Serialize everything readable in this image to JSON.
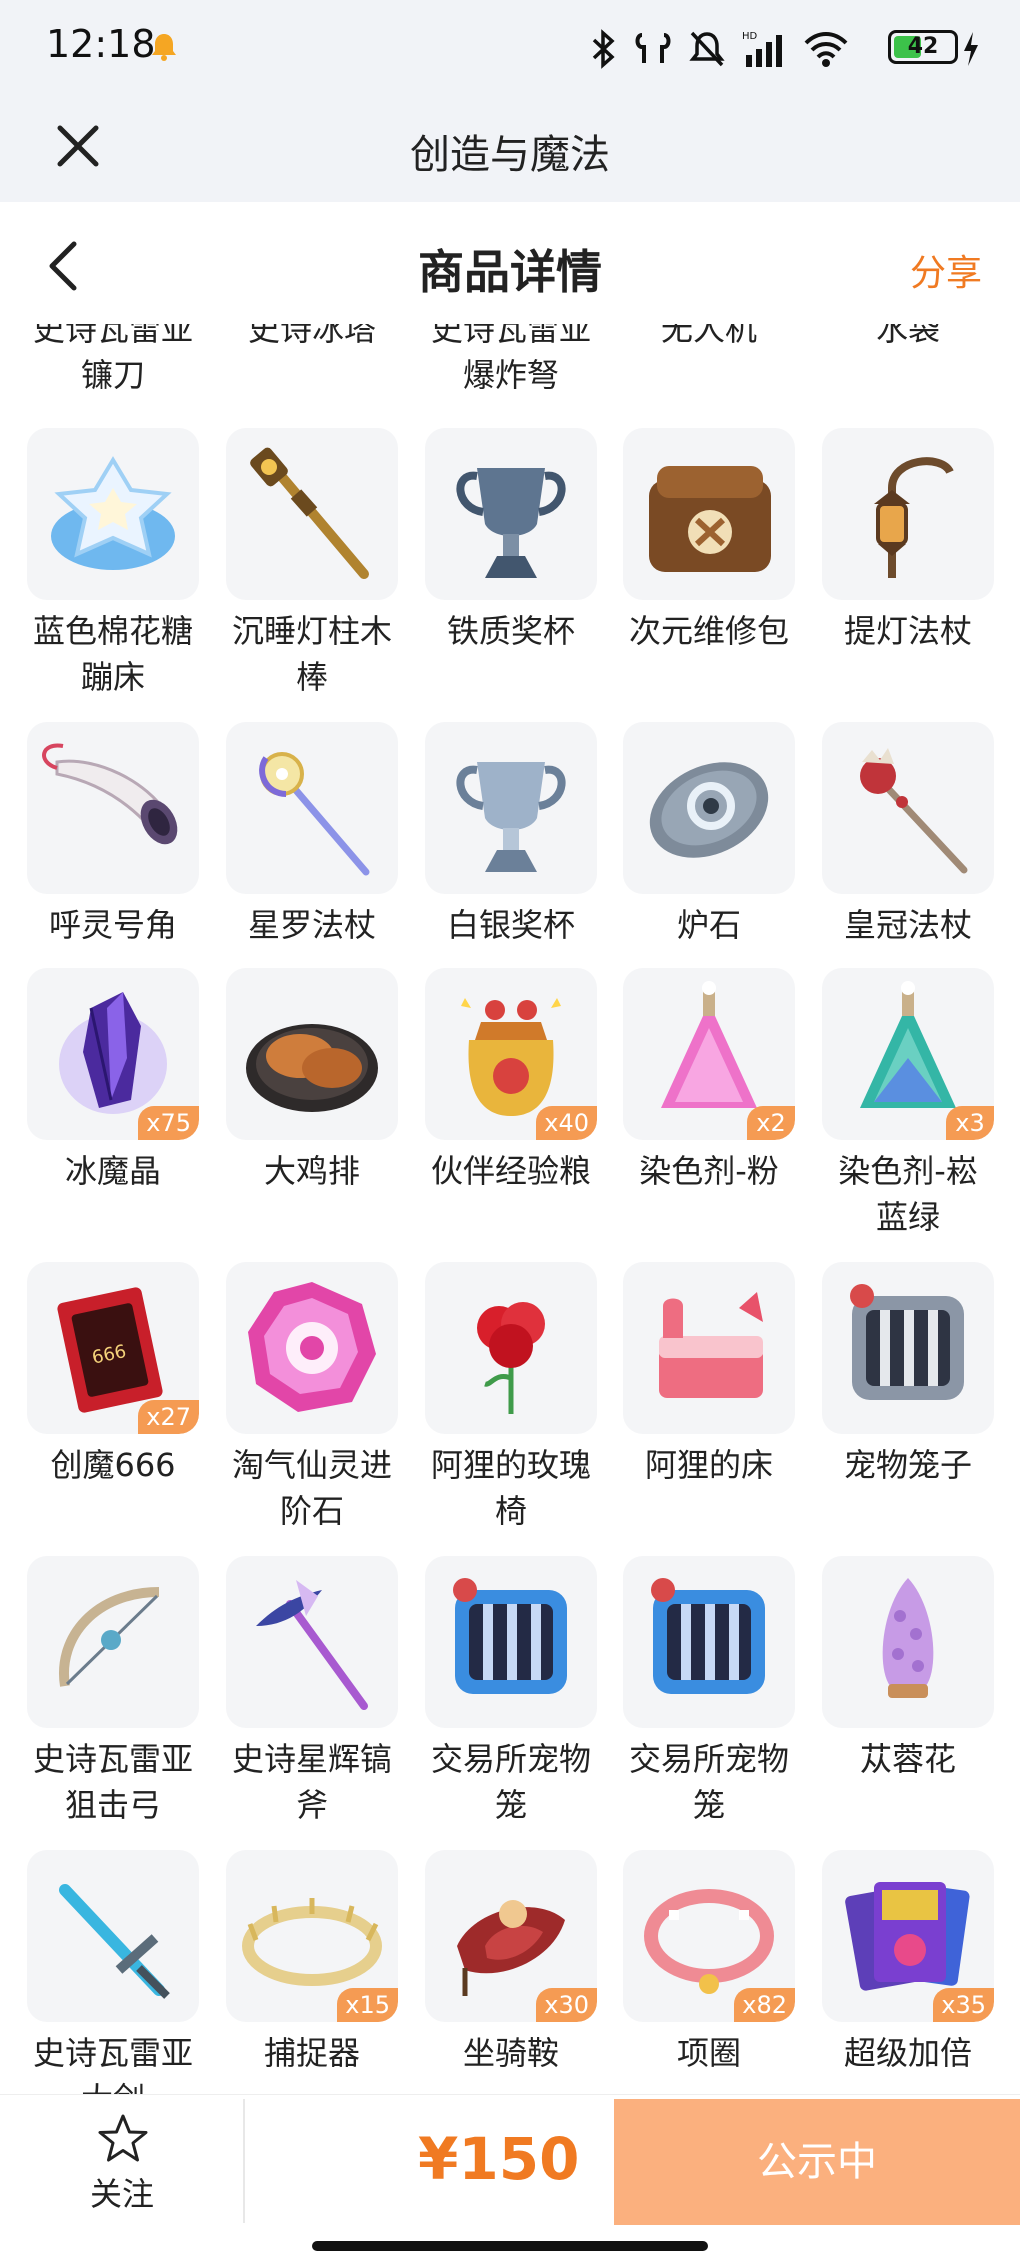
{
  "status_bar": {
    "time": "12:18",
    "battery": "42"
  },
  "app_bar": {
    "title": "创造与魔法"
  },
  "header": {
    "title": "商品详情",
    "share": "分享"
  },
  "grid": {
    "partial_row": [
      {
        "name": "史诗瓦雷亚\n镰刀"
      },
      {
        "name": "史诗冰塔"
      },
      {
        "name": "史诗瓦雷亚\n爆炸弩"
      },
      {
        "name": "无人机"
      },
      {
        "name": "水袋"
      }
    ],
    "rows": [
      [
        {
          "name": "蓝色棉花糖蹦床",
          "icon": "cotton-candy-trampoline-icon",
          "qty": ""
        },
        {
          "name": "沉睡灯柱木棒",
          "icon": "lamp-post-stick-icon",
          "qty": ""
        },
        {
          "name": "铁质奖杯",
          "icon": "iron-trophy-icon",
          "qty": ""
        },
        {
          "name": "次元维修包",
          "icon": "repair-bag-icon",
          "qty": ""
        },
        {
          "name": "提灯法杖",
          "icon": "lantern-staff-icon",
          "qty": ""
        }
      ],
      [
        {
          "name": "呼灵号角",
          "icon": "horn-icon",
          "qty": ""
        },
        {
          "name": "星罗法杖",
          "icon": "star-staff-icon",
          "qty": ""
        },
        {
          "name": "白银奖杯",
          "icon": "silver-trophy-icon",
          "qty": ""
        },
        {
          "name": "炉石",
          "icon": "hearthstone-icon",
          "qty": ""
        },
        {
          "name": "皇冠法杖",
          "icon": "crown-staff-icon",
          "qty": ""
        }
      ],
      [
        {
          "name": "冰魔晶",
          "icon": "ice-crystal-icon",
          "qty": "x75"
        },
        {
          "name": "大鸡排",
          "icon": "chicken-cutlet-icon",
          "qty": ""
        },
        {
          "name": "伙伴经验粮",
          "icon": "pet-food-bag-icon",
          "qty": "x40"
        },
        {
          "name": "染色剂-粉",
          "icon": "pink-dye-icon",
          "qty": "x2"
        },
        {
          "name": "染色剂-崧蓝绿",
          "icon": "teal-dye-icon",
          "qty": "x3"
        }
      ],
      [
        {
          "name": "创魔666",
          "icon": "card-666-icon",
          "qty": "x27"
        },
        {
          "name": "淘气仙灵进阶石",
          "icon": "advance-stone-icon",
          "qty": ""
        },
        {
          "name": "阿狸的玫瑰椅",
          "icon": "rose-chair-icon",
          "qty": ""
        },
        {
          "name": "阿狸的床",
          "icon": "pink-bed-icon",
          "qty": ""
        },
        {
          "name": "宠物笼子",
          "icon": "pet-cage-icon",
          "qty": ""
        }
      ],
      [
        {
          "name": "史诗瓦雷亚狙击弓",
          "icon": "bow-icon",
          "qty": ""
        },
        {
          "name": "史诗星辉镐斧",
          "icon": "pickaxe-icon",
          "qty": ""
        },
        {
          "name": "交易所宠物笼",
          "icon": "blue-pet-cage-icon",
          "qty": ""
        },
        {
          "name": "交易所宠物笼",
          "icon": "blue-pet-cage-icon",
          "qty": ""
        },
        {
          "name": "苁蓉花",
          "icon": "cistanche-flower-icon",
          "qty": ""
        }
      ],
      [
        {
          "name": "史诗瓦雷亚大剑",
          "icon": "greatsword-icon",
          "qty": ""
        },
        {
          "name": "捕捉器",
          "icon": "catcher-icon",
          "qty": "x15"
        },
        {
          "name": "坐骑鞍",
          "icon": "saddle-icon",
          "qty": "x30"
        },
        {
          "name": "项圈",
          "icon": "collar-icon",
          "qty": "x82"
        },
        {
          "name": "超级加倍",
          "icon": "super-double-card-icon",
          "qty": "x35"
        }
      ]
    ]
  },
  "bottom": {
    "follow": "关注",
    "price": "¥150",
    "status": "公示中"
  },
  "colors": {
    "accent": "#f07a22",
    "badge": "#f59b53",
    "status_button": "#fbb07e",
    "tile_bg": "#f4f5f7",
    "chrome_bg": "#f1f3f7"
  }
}
